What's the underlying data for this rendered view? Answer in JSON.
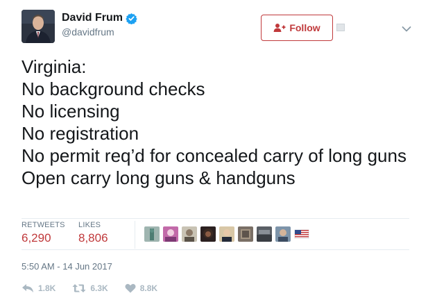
{
  "author": {
    "display_name": "David Frum",
    "handle": "@davidfrum",
    "verified": true
  },
  "follow_button": {
    "label": "Follow"
  },
  "tweet": {
    "text": "Virginia:\nNo background checks\nNo licensing\nNo registration\nNo permit req’d for concealed carry of long guns\nOpen carry long guns & handguns"
  },
  "stats": {
    "retweets_label": "RETWEETS",
    "retweets_value": "6,290",
    "likes_label": "LIKES",
    "likes_value": "8,806"
  },
  "timestamp": "5:50 AM - 14 Jun 2017",
  "actions": {
    "reply_count": "1.8K",
    "retweet_count": "6.3K",
    "like_count": "8.8K"
  },
  "colors": {
    "accent": "#c0393b",
    "verified": "#1da1f2",
    "muted": "#657786",
    "action_grey": "#aab8c2"
  },
  "icons": [
    "verified-badge-icon",
    "follow-person-plus-icon",
    "caret-down-icon",
    "reply-icon",
    "retweet-icon",
    "heart-icon"
  ]
}
